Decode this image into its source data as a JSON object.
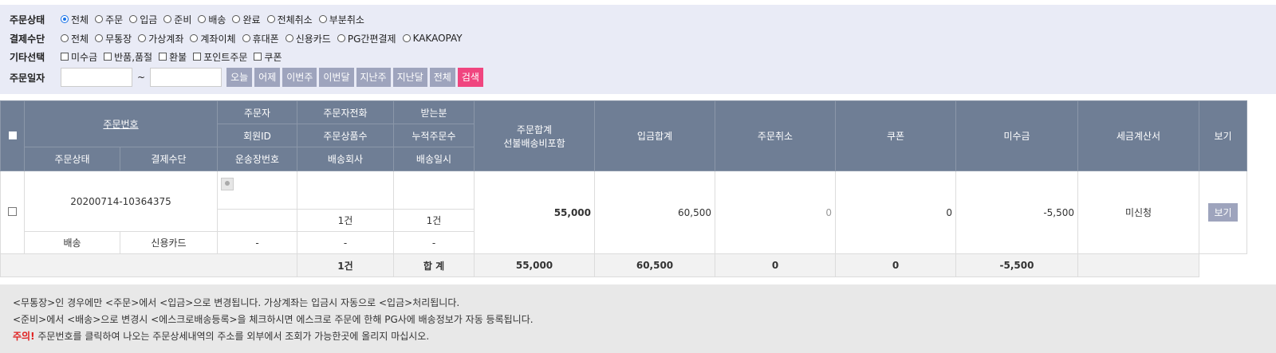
{
  "filters": {
    "order_status": {
      "label": "주문상태",
      "options": [
        "전체",
        "주문",
        "입금",
        "준비",
        "배송",
        "완료",
        "전체취소",
        "부분취소"
      ],
      "selected_index": 0
    },
    "payment": {
      "label": "결제수단",
      "options": [
        "전체",
        "무통장",
        "가상계좌",
        "계좌이체",
        "휴대폰",
        "신용카드",
        "PG간편결제",
        "KAKAOPAY"
      ]
    },
    "etc": {
      "label": "기타선택",
      "options": [
        "미수금",
        "반품,품절",
        "환불",
        "포인트주문",
        "쿠폰"
      ]
    },
    "date": {
      "label": "주문일자",
      "tilde": "~",
      "from_value": "",
      "to_value": "",
      "buttons": [
        "오늘",
        "어제",
        "이번주",
        "이번달",
        "지난주",
        "지난달",
        "전체"
      ],
      "search_label": "검색"
    }
  },
  "table": {
    "headers": {
      "order_no": "주문번호",
      "orderer": "주문자",
      "orderer_phone": "주문자전화",
      "receiver": "받는분",
      "member_id": "회원ID",
      "item_count": "주문상품수",
      "cumulative_orders": "누적주문수",
      "order_status": "주문상태",
      "payment": "결제수단",
      "tracking_no": "운송장번호",
      "courier": "배송회사",
      "ship_date": "배송일시",
      "order_total_1": "주문합계",
      "order_total_2": "선불배송비포함",
      "deposit_total": "입금합계",
      "cancel": "주문취소",
      "coupon": "쿠폰",
      "unpaid": "미수금",
      "tax_invoice": "세금계산서",
      "view": "보기"
    },
    "row": {
      "order_no": "20200714-10364375",
      "item_count": "1건",
      "cumulative_orders": "1건",
      "status": "배송",
      "payment": "신용카드",
      "tracking_no": "-",
      "courier": "-",
      "ship_date": "-",
      "order_total": "55,000",
      "deposit_total": "60,500",
      "cancel": "0",
      "coupon": "0",
      "unpaid": "-5,500",
      "tax_invoice": "미신청",
      "view_button": "보기"
    },
    "footer": {
      "count": "1건",
      "sum_label": "합 계",
      "order_total": "55,000",
      "deposit_total": "60,500",
      "cancel": "0",
      "coupon": "0",
      "unpaid": "-5,500"
    }
  },
  "notice": {
    "line1": "<무통장>인 경우에만 <주문>에서 <입금>으로 변경됩니다. 가상계좌는 입금시 자동으로 <입금>처리됩니다.",
    "line2": "<준비>에서 <배송>으로 변경시 <에스크로배송등록>을 체크하시면 에스크로 주문에 한해 PG사에 배송정보가 자동 등록됩니다.",
    "warn_label": "주의!",
    "line3": " 주문번호를 클릭하여 나오는 주문상세내역의 주소를 외부에서 조회가 가능한곳에 올리지 마십시오."
  }
}
